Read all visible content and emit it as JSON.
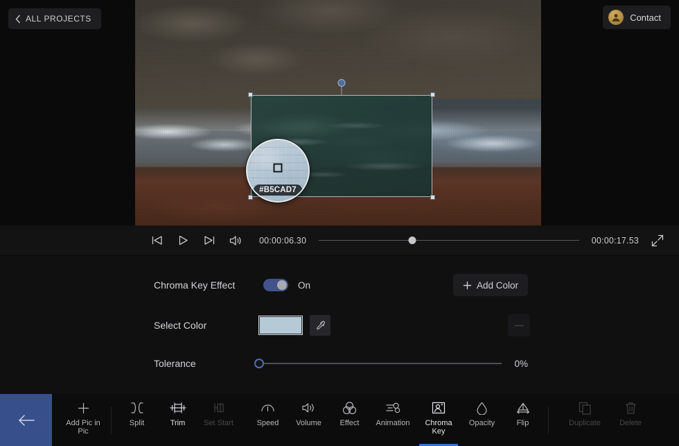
{
  "header": {
    "all_projects_label": "ALL PROJECTS",
    "back_chevron_icon": "chevron-left-icon",
    "contact_label": "Contact",
    "avatar_icon": "user-avatar-icon"
  },
  "preview": {
    "pip_selection": {
      "handles": [
        "top-left",
        "top-right",
        "bottom-left",
        "bottom-right"
      ],
      "rotation_handle": "rotate-handle"
    },
    "eyedropper_magnifier": {
      "picked_color_hex": "#B5CAD7",
      "cursor_icon": "pixel-cursor-icon"
    }
  },
  "playback": {
    "prev_frame_icon": "skip-previous-icon",
    "play_icon": "play-icon",
    "next_frame_icon": "skip-next-icon",
    "volume_icon": "volume-icon",
    "current_time": "00:00:06.30",
    "total_time": "00:00:17.53",
    "progress_percent": 36,
    "fullscreen_icon": "fullscreen-icon"
  },
  "properties": {
    "chroma_key": {
      "label": "Chroma Key Effect",
      "toggle_state": "On",
      "toggle_on": true,
      "accent_color": "#41538A"
    },
    "add_color": {
      "label": "Add Color",
      "plus_icon": "plus-icon"
    },
    "select_color": {
      "label": "Select Color",
      "swatch_color": "#B5CAD7",
      "eyedropper_icon": "eyedropper-icon",
      "remove_icon": "minus-icon"
    },
    "tolerance": {
      "label": "Tolerance",
      "value": "0%",
      "value_percent": 0
    }
  },
  "toolbar": {
    "back_icon": "arrow-left-icon",
    "back_bg_color": "#37508C",
    "active_indicator_color": "#3D6FD0",
    "items": [
      {
        "label": "Add Pic in\nPic",
        "label_line1": "Add Pic in",
        "label_line2": "Pic",
        "icon": "plus-icon",
        "state": "enabled"
      },
      {
        "label": "Split",
        "icon": "split-icon",
        "state": "enabled"
      },
      {
        "label": "Trim",
        "icon": "trim-icon",
        "state": "enabled"
      },
      {
        "label": "Set Start",
        "icon": "set-start-icon",
        "state": "disabled"
      },
      {
        "label": "Speed",
        "icon": "speed-icon",
        "state": "enabled"
      },
      {
        "label": "Volume",
        "icon": "volume-icon",
        "state": "enabled"
      },
      {
        "label": "Effect",
        "icon": "effect-icon",
        "state": "enabled"
      },
      {
        "label": "Animation",
        "icon": "animation-icon",
        "state": "enabled"
      },
      {
        "label": "Chroma\nKey",
        "label_line1": "Chroma",
        "label_line2": "Key",
        "icon": "chroma-key-icon",
        "state": "active"
      },
      {
        "label": "Opacity",
        "icon": "opacity-icon",
        "state": "enabled"
      },
      {
        "label": "Flip",
        "icon": "flip-icon",
        "state": "enabled"
      },
      {
        "label": "Duplicate",
        "icon": "duplicate-icon",
        "state": "disabled"
      },
      {
        "label": "Delete",
        "icon": "delete-icon",
        "state": "disabled"
      }
    ]
  }
}
